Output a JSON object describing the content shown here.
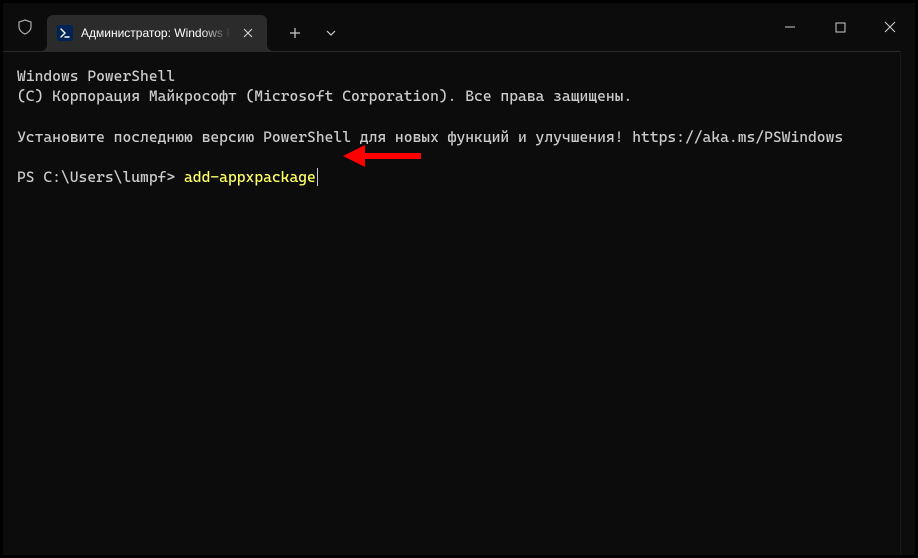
{
  "titlebar": {
    "tab_title": "Администратор: Windows PowerShell"
  },
  "terminal": {
    "line1": "Windows PowerShell",
    "line2": "(C) Корпорация Майкрософт (Microsoft Corporation). Все права защищены.",
    "line3": "Установите последнюю версию PowerShell для новых функций и улучшения! https://aka.ms/PSWindows",
    "prompt": "PS C:\\Users\\lumpf> ",
    "command": "add-appxpackage"
  },
  "colors": {
    "background": "#0c0c0c",
    "tab_bg": "#2b2b2b",
    "text": "#cccccc",
    "command": "#ffff66",
    "ps_icon_bg": "#012456",
    "arrow": "#ff0000"
  }
}
